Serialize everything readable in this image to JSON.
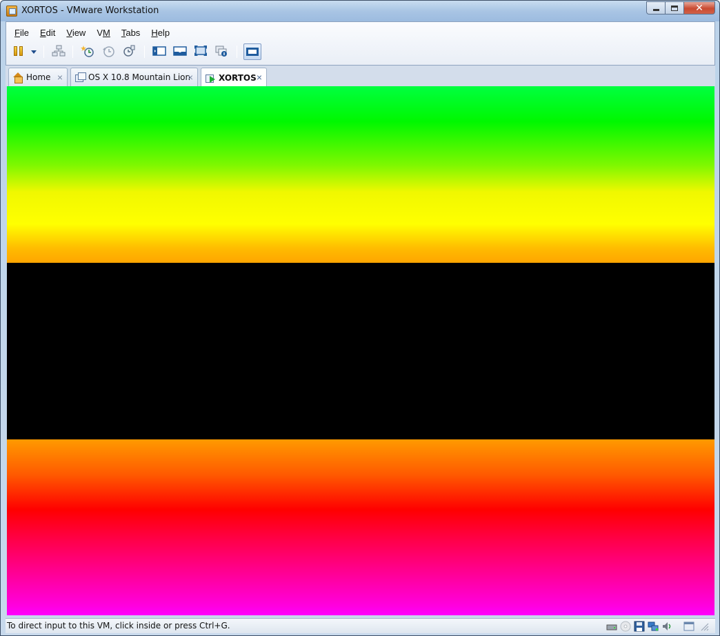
{
  "window": {
    "title": "XORTOS - VMware Workstation",
    "icon": "vmware-app-icon",
    "controls": [
      "minimize-icon",
      "maximize-icon",
      "close-icon"
    ]
  },
  "menu": [
    {
      "label": "File",
      "mnemonic": "F"
    },
    {
      "label": "Edit",
      "mnemonic": "E"
    },
    {
      "label": "View",
      "mnemonic": "V"
    },
    {
      "label": "VM",
      "mnemonic": "M"
    },
    {
      "label": "Tabs",
      "mnemonic": "T"
    },
    {
      "label": "Help",
      "mnemonic": "H"
    }
  ],
  "toolbar": {
    "buttons": [
      "pause-icon",
      "dropdown-icon",
      "network-icon",
      "take-snapshot-icon",
      "revert-snapshot-icon",
      "snapshot-manager-icon",
      "show-library-icon",
      "console-view-icon",
      "full-screen-icon",
      "unity-icon",
      "quick-switch-icon"
    ]
  },
  "tabs": [
    {
      "label": "Home",
      "icon": "home-icon",
      "active": false
    },
    {
      "label": "OS X 10.8 Mountain Lion",
      "icon": "vm-icon",
      "active": false
    },
    {
      "label": "XORTOS",
      "icon": "vm-running-icon",
      "active": true
    }
  ],
  "tab_close_glyph": "×",
  "vm_display": {
    "colors": {
      "top_band": [
        "#00ff40",
        "#00f800",
        "#ffff00",
        "#ffa500"
      ],
      "middle_band": "#000000",
      "bottom_band": [
        "#ff9a00",
        "#ff0000",
        "#ff00ff"
      ]
    }
  },
  "statusbar": {
    "text": "To direct input to this VM, click inside or press Ctrl+G.",
    "icons": [
      "hard-disk-icon",
      "cd-dvd-icon",
      "floppy-icon",
      "network-adapter-icon",
      "sound-icon",
      "message-log-icon"
    ]
  }
}
